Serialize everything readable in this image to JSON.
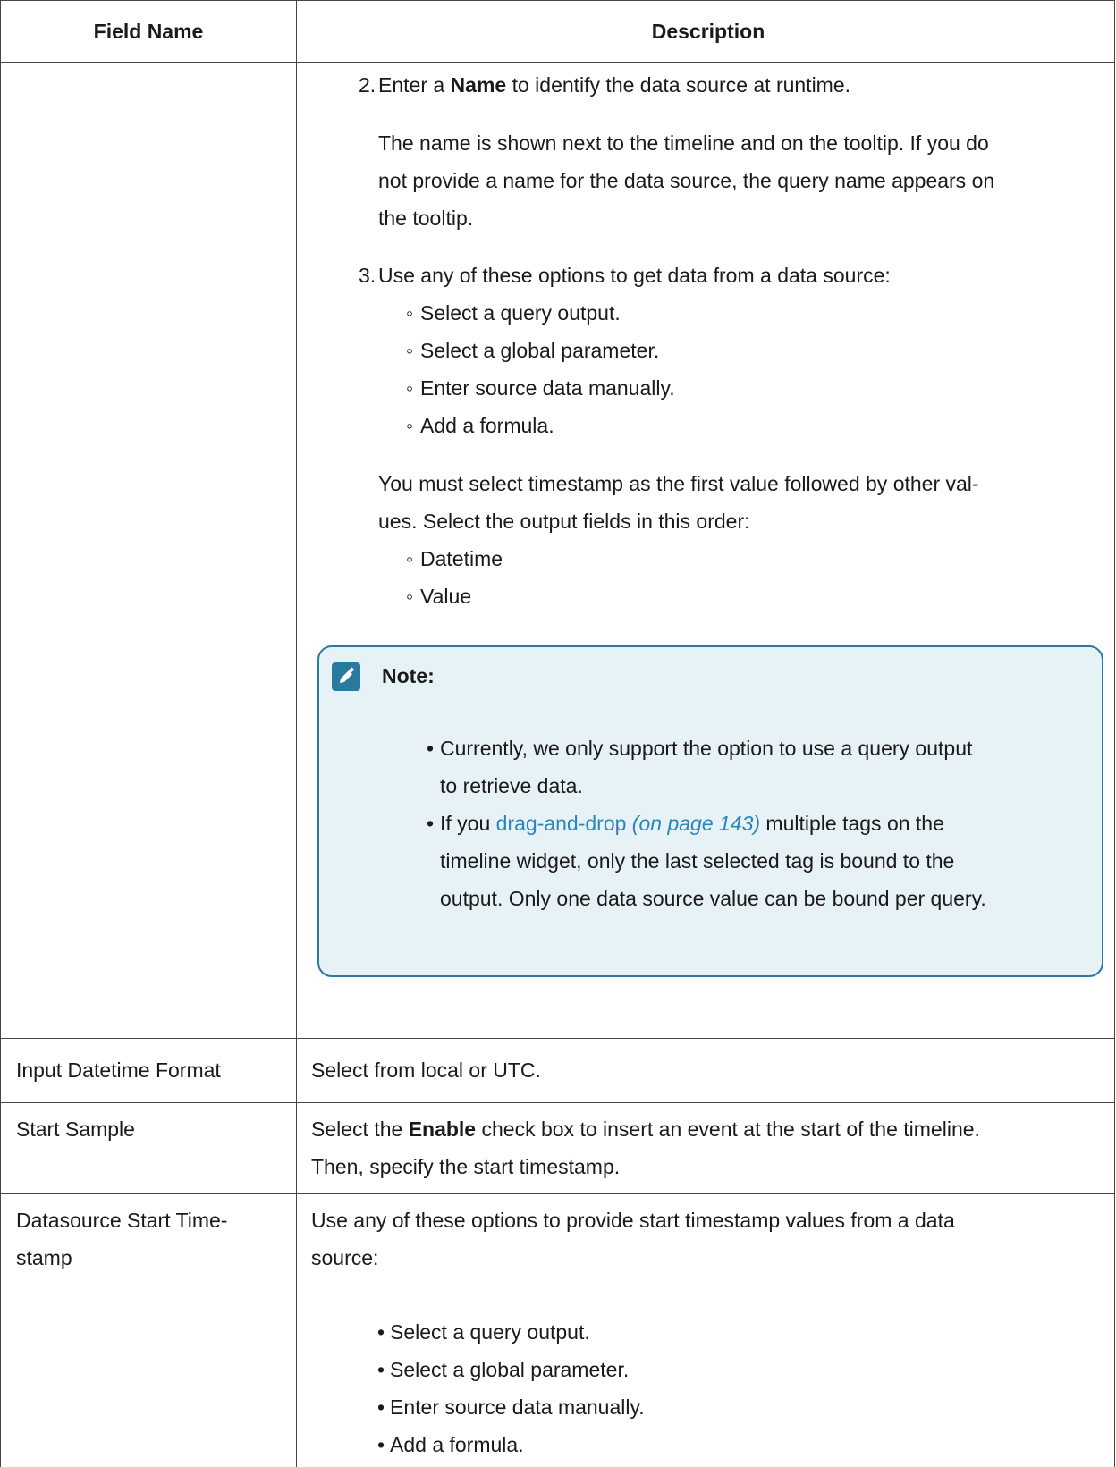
{
  "header": {
    "col1": "Field Name",
    "col2": "Description"
  },
  "row1": {
    "step2": {
      "num": "2.",
      "pre": "Enter a ",
      "bold": "Name",
      "post": " to identify the data source at runtime.",
      "para": [
        "The name is shown next to the timeline and on the tooltip. If you do",
        "not provide a name for the data source, the query name appears on",
        "the tooltip."
      ]
    },
    "step3": {
      "num": "3.",
      "text": "Use any of these options to get data from a data source:",
      "options": [
        "Select a query output.",
        "Select a global parameter.",
        "Enter source data manually.",
        "Add a formula."
      ],
      "para": [
        "You must select timestamp as the first value followed by other val-",
        "ues. Select the output fields in this order:"
      ],
      "fields": [
        "Datetime",
        "Value"
      ]
    },
    "note": {
      "title": "Note:",
      "item1": [
        "Currently, we only support the option to use a query output",
        "to retrieve data."
      ],
      "item2": {
        "pre": "If you ",
        "link": "drag-and-drop",
        "ref": " (on page 143)",
        "post": " multiple tags on the",
        "lines": [
          "timeline widget, only the last selected tag is bound to the",
          "output. Only one data source value can be bound per query."
        ]
      }
    }
  },
  "row2": {
    "name": "Input Datetime Format",
    "desc": "Select from local or UTC."
  },
  "row3": {
    "name": "Start Sample",
    "pre": "Select the ",
    "bold": "Enable",
    "post": " check box to insert an event at the start of the timeline.",
    "line2": "Then, specify the start timestamp."
  },
  "row4": {
    "name": [
      "Datasource Start Time-",
      "stamp"
    ],
    "desc": [
      "Use any of these options to provide start timestamp values from a data",
      "source:"
    ],
    "options": [
      "Select a query output.",
      "Select a global parameter.",
      "Enter source data manually.",
      "Add a formula."
    ]
  }
}
